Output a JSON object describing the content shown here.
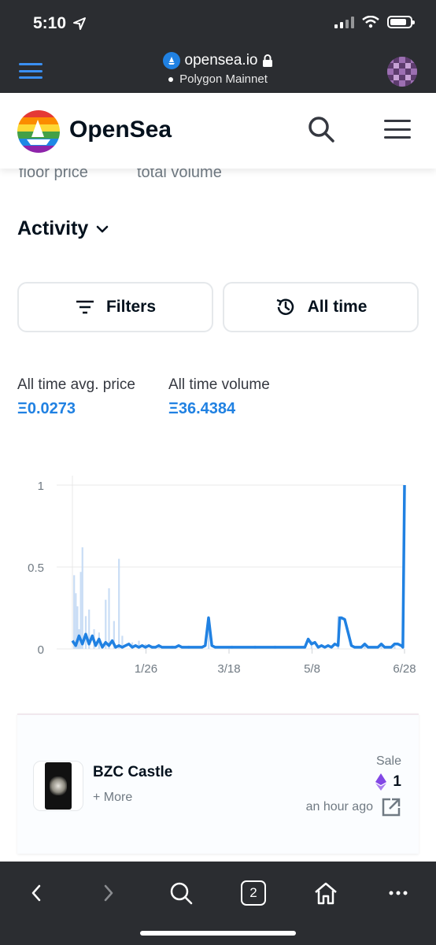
{
  "status_bar": {
    "time": "5:10"
  },
  "browser": {
    "url": "opensea.io",
    "network": "Polygon Mainnet"
  },
  "site": {
    "name": "OpenSea"
  },
  "stats_partial": {
    "floor_label": "floor price",
    "volume_label": "total volume"
  },
  "activity": {
    "title": "Activity"
  },
  "buttons": {
    "filters": "Filters",
    "time_range": "All time"
  },
  "summary": {
    "avg_label": "All time avg. price",
    "avg_value": "Ξ0.0273",
    "volume_label": "All time volume",
    "volume_value": "Ξ36.4384"
  },
  "chart_data": {
    "type": "line",
    "x_ticks": [
      "1/26",
      "3/18",
      "5/8",
      "6/28"
    ],
    "y_ticks": [
      "0",
      "0.5",
      "1"
    ],
    "ylim": [
      0,
      1
    ],
    "grid": true,
    "series": [
      {
        "line_color": "#2081e2",
        "points": [
          [
            0,
            0.05
          ],
          [
            0.01,
            0.02
          ],
          [
            0.02,
            0.08
          ],
          [
            0.03,
            0.03
          ],
          [
            0.04,
            0.09
          ],
          [
            0.05,
            0.03
          ],
          [
            0.06,
            0.08
          ],
          [
            0.07,
            0.02
          ],
          [
            0.08,
            0.06
          ],
          [
            0.09,
            0.01
          ],
          [
            0.1,
            0.04
          ],
          [
            0.11,
            0.02
          ],
          [
            0.12,
            0.05
          ],
          [
            0.13,
            0.01
          ],
          [
            0.14,
            0.02
          ],
          [
            0.15,
            0.01
          ],
          [
            0.16,
            0.02
          ],
          [
            0.17,
            0.03
          ],
          [
            0.18,
            0.01
          ],
          [
            0.19,
            0.02
          ],
          [
            0.2,
            0.01
          ],
          [
            0.21,
            0.02
          ],
          [
            0.22,
            0.01
          ],
          [
            0.23,
            0.02
          ],
          [
            0.24,
            0.01
          ],
          [
            0.25,
            0.01
          ],
          [
            0.26,
            0.02
          ],
          [
            0.27,
            0.01
          ],
          [
            0.28,
            0.01
          ],
          [
            0.29,
            0.01
          ],
          [
            0.3,
            0.01
          ],
          [
            0.31,
            0.01
          ],
          [
            0.32,
            0.02
          ],
          [
            0.33,
            0.01
          ],
          [
            0.34,
            0.01
          ],
          [
            0.35,
            0.01
          ],
          [
            0.36,
            0.01
          ],
          [
            0.37,
            0.01
          ],
          [
            0.38,
            0.01
          ],
          [
            0.39,
            0.01
          ],
          [
            0.4,
            0.02
          ],
          [
            0.41,
            0.19
          ],
          [
            0.42,
            0.02
          ],
          [
            0.43,
            0.01
          ],
          [
            0.44,
            0.01
          ],
          [
            0.45,
            0.01
          ],
          [
            0.46,
            0.01
          ],
          [
            0.47,
            0.01
          ],
          [
            0.48,
            0.01
          ],
          [
            0.5,
            0.01
          ],
          [
            0.52,
            0.01
          ],
          [
            0.54,
            0.01
          ],
          [
            0.56,
            0.01
          ],
          [
            0.58,
            0.01
          ],
          [
            0.6,
            0.01
          ],
          [
            0.62,
            0.01
          ],
          [
            0.63,
            0.01
          ],
          [
            0.64,
            0.01
          ],
          [
            0.65,
            0.01
          ],
          [
            0.66,
            0.01
          ],
          [
            0.67,
            0.01
          ],
          [
            0.68,
            0.01
          ],
          [
            0.69,
            0.01
          ],
          [
            0.7,
            0.01
          ],
          [
            0.71,
            0.06
          ],
          [
            0.72,
            0.03
          ],
          [
            0.73,
            0.04
          ],
          [
            0.74,
            0.01
          ],
          [
            0.75,
            0.02
          ],
          [
            0.76,
            0.01
          ],
          [
            0.77,
            0.02
          ],
          [
            0.78,
            0.01
          ],
          [
            0.79,
            0.03
          ],
          [
            0.8,
            0.02
          ],
          [
            0.805,
            0.19
          ],
          [
            0.81,
            0.19
          ],
          [
            0.82,
            0.18
          ],
          [
            0.83,
            0.1
          ],
          [
            0.84,
            0.02
          ],
          [
            0.85,
            0.01
          ],
          [
            0.86,
            0.01
          ],
          [
            0.87,
            0.01
          ],
          [
            0.88,
            0.03
          ],
          [
            0.89,
            0.01
          ],
          [
            0.9,
            0.01
          ],
          [
            0.91,
            0.01
          ],
          [
            0.92,
            0.01
          ],
          [
            0.93,
            0.03
          ],
          [
            0.94,
            0.01
          ],
          [
            0.95,
            0.01
          ],
          [
            0.96,
            0.01
          ],
          [
            0.97,
            0.03
          ],
          [
            0.98,
            0.03
          ],
          [
            0.99,
            0.02
          ],
          [
            0.995,
            0.01
          ],
          [
            1,
            1
          ]
        ]
      },
      {
        "bar_color": "#c9ddf5",
        "bars": [
          [
            0.005,
            0.45
          ],
          [
            0.01,
            0.34
          ],
          [
            0.015,
            0.26
          ],
          [
            0.02,
            0.12
          ],
          [
            0.025,
            0.47
          ],
          [
            0.03,
            0.62
          ],
          [
            0.04,
            0.2
          ],
          [
            0.05,
            0.24
          ],
          [
            0.065,
            0.12
          ],
          [
            0.08,
            0.1
          ],
          [
            0.1,
            0.3
          ],
          [
            0.11,
            0.37
          ],
          [
            0.125,
            0.17
          ],
          [
            0.14,
            0.55
          ],
          [
            0.15,
            0.08
          ],
          [
            0.18,
            0.04
          ],
          [
            0.2,
            0.05
          ],
          [
            0.22,
            0.03
          ],
          [
            0.24,
            0.02
          ],
          [
            0.26,
            0.03
          ],
          [
            0.3,
            0.02
          ],
          [
            0.35,
            0.02
          ],
          [
            0.41,
            0.2
          ],
          [
            0.48,
            0.02
          ],
          [
            0.55,
            0.02
          ],
          [
            0.61,
            0.02
          ],
          [
            0.7,
            0.02
          ],
          [
            0.72,
            0.05
          ],
          [
            0.8,
            0.2
          ],
          [
            0.88,
            0.03
          ],
          [
            0.93,
            0.02
          ],
          [
            0.97,
            0.02
          ]
        ]
      }
    ]
  },
  "listing": {
    "item_name": "BZC Castle",
    "more": "+ More",
    "event": "Sale",
    "price": "1",
    "time": "an hour ago"
  },
  "toolbar": {
    "tabs_count": "2"
  }
}
